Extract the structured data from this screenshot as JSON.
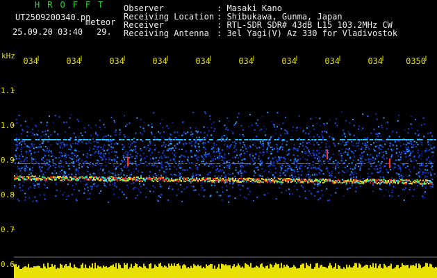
{
  "header": {
    "program": "HROFFT",
    "filename": "UT2509200340.pn",
    "meteor_label": "meteor",
    "datetime": "25.09.20 03:40",
    "count": "29.",
    "info": [
      {
        "label": "Observer",
        "value": ": Masaki Kano"
      },
      {
        "label": "Receiving Location",
        "value": ": Shibukawa, Gunma, Japan"
      },
      {
        "label": "Receiver",
        "value": ": RTL-SDR SDR# 43dB L15 103.2MHz CW"
      },
      {
        "label": "Receiving Antenna",
        "value": ": 3el Yagi(V) Az 330 for Vladivostok"
      }
    ]
  },
  "axes": {
    "y_unit": "kHz",
    "y_ticks": [
      "1.1",
      "1.0",
      "0.9",
      "0.8",
      "0.7",
      "0.6"
    ],
    "x_ticks": [
      "034",
      "034",
      "034",
      "034",
      "034",
      "034",
      "034",
      "034",
      "034",
      "0350"
    ]
  },
  "colors": {
    "label_green": "#2fd13a",
    "text_white": "#f0f0f0",
    "tick_yellow": "#e8e000",
    "signal_red": "#ff2020",
    "noise_blue": "#1030c0",
    "noise_cyan": "#30c0ff"
  }
}
